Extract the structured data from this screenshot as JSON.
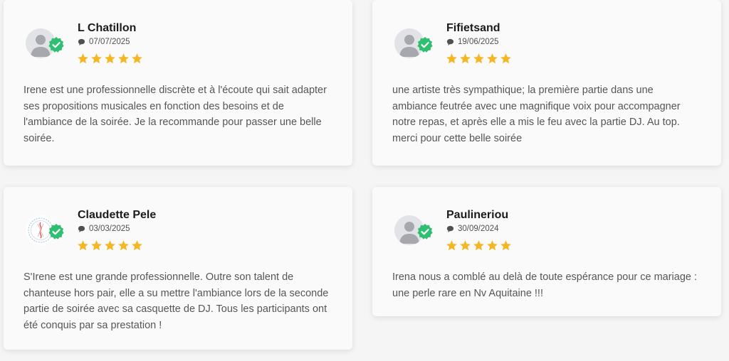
{
  "colors": {
    "star": "#f5b624",
    "badge": "#2fbf71",
    "avatar_bg": "#e2e3e6",
    "avatar_fg": "#a6a8ad"
  },
  "reviews": [
    {
      "name": "L Chatillon",
      "date": "07/07/2025",
      "rating": 5,
      "avatar_icon": "default-user-icon",
      "text": "Irene est une professionnelle discrète et à l'écoute qui sait adapter ses propositions musicales en fonction des besoins et de l'ambiance de la soirée. Je la recommande pour passer une belle soirée."
    },
    {
      "name": "Fifietsand",
      "date": "19/06/2025",
      "rating": 5,
      "avatar_icon": "default-user-icon",
      "text": "une artiste très sympathique; la première partie dans une ambiance feutrée avec une magnifique voix pour accompagner notre repas, et après elle a mis le feu avec la partie DJ. Au top. merci pour cette belle soirée"
    },
    {
      "name": "Claudette Pele",
      "date": "03/03/2025",
      "rating": 5,
      "avatar_icon": "circular-logo-icon",
      "text": "S'Irene est une grande professionnelle. Outre son talent de chanteuse hors pair, elle a su mettre l'ambiance lors de la seconde partie de soirée avec sa casquette de DJ. Tous les participants ont été conquis par sa prestation !"
    },
    {
      "name": "Paulineriou",
      "date": "30/09/2024",
      "rating": 5,
      "avatar_icon": "default-user-icon",
      "text": "Irena nous a comblé au delà de toute espérance pour ce mariage : une perle rare en Nv Aquitaine !!!"
    }
  ]
}
